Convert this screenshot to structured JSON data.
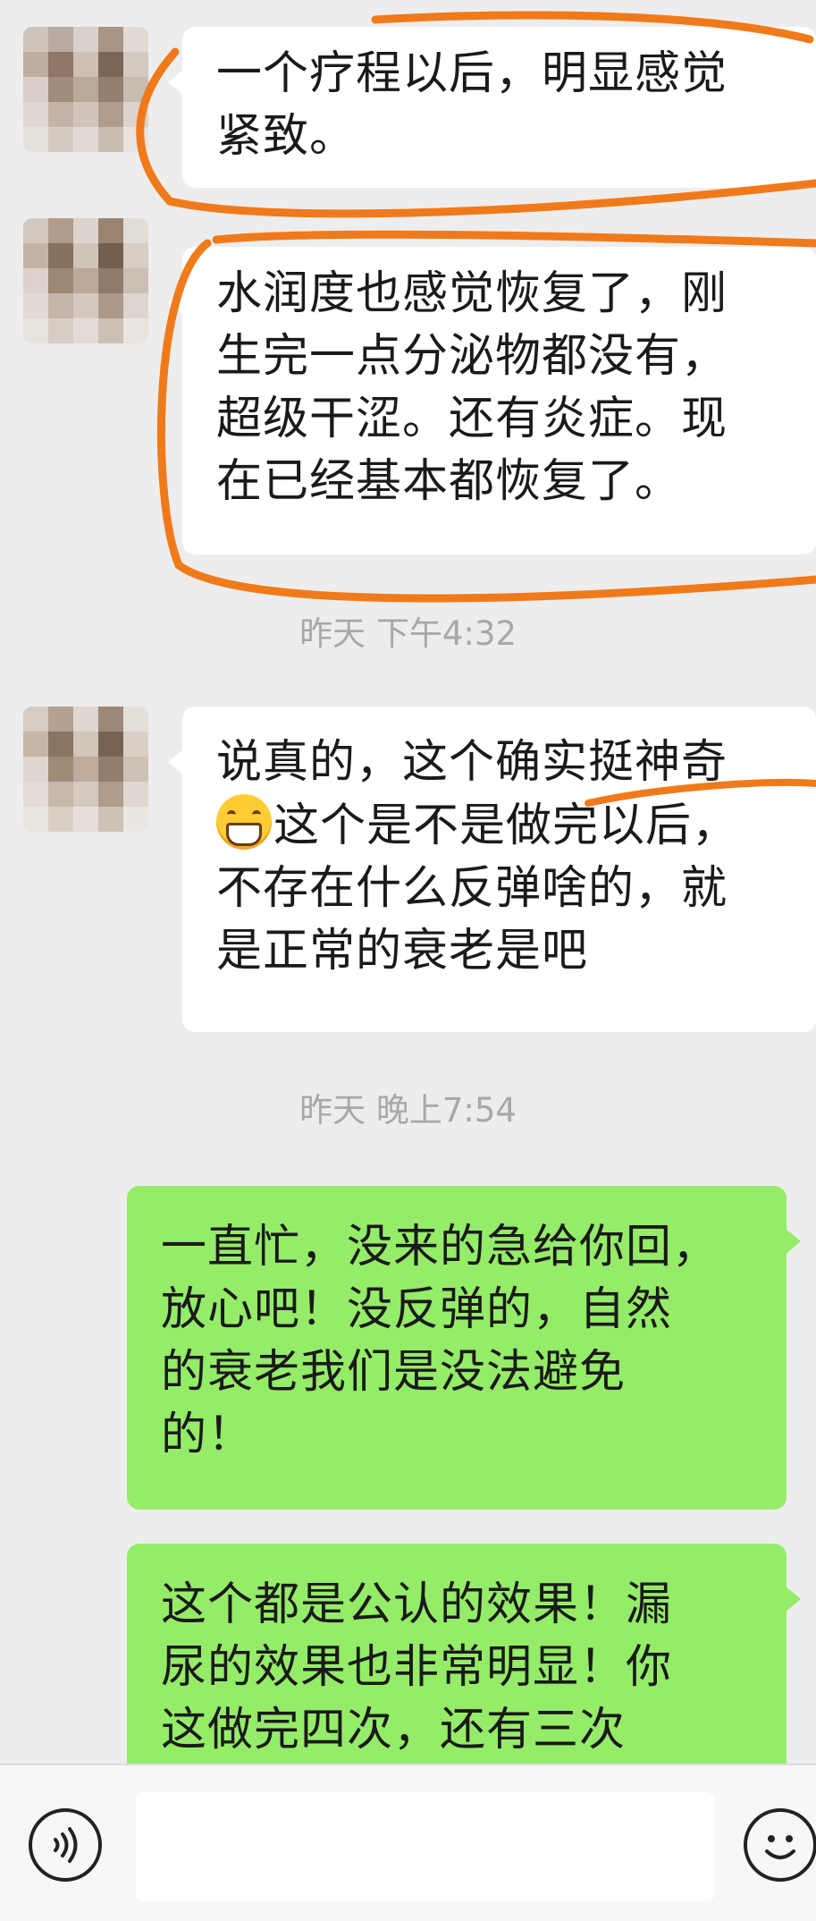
{
  "messages": {
    "m1": {
      "lines": [
        "一个疗程以后，明显感觉",
        "紧致。"
      ]
    },
    "m2": {
      "lines": [
        "水润度也感觉恢复了，刚",
        "生完一点分泌物都没有，",
        "超级干涩。还有炎症。现",
        "在已经基本都恢复了。"
      ]
    },
    "ts1": "昨天 下午4:32",
    "m3": {
      "lines": [
        "说真的，这个确实挺神奇",
        "这个是不是做完以后，",
        "不存在什么反弹啥的，就",
        "是正常的衰老是吧"
      ],
      "emoji": "grinning-face-icon"
    },
    "ts2": "昨天 晚上7:54",
    "m4": {
      "lines": [
        "一直忙，没来的急给你回，",
        "放心吧！没反弹的，自然",
        "的衰老我们是没法避免",
        "的！"
      ]
    },
    "m5": {
      "lines": [
        "这个都是公认的效果！漏",
        "尿的效果也非常明显！你",
        "这做完四次，还有三次"
      ]
    }
  },
  "colors": {
    "background": "#ededed",
    "incoming": "#ffffff",
    "outgoing": "#95ec69",
    "annotation": "#f07a1a"
  },
  "input": {
    "placeholder": ""
  },
  "icons": {
    "voice": "voice-icon",
    "emoji": "emoji-icon"
  }
}
